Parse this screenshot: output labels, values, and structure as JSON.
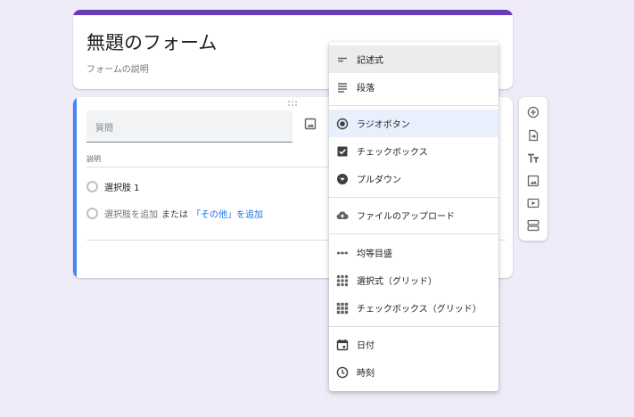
{
  "form": {
    "title": "無題のフォーム",
    "description": "フォームの説明"
  },
  "question": {
    "placeholder": "質問",
    "description_label": "説明",
    "option1": "選択肢 1",
    "add_option": "選択肢を追加",
    "or": "または",
    "add_other": "「その他」を追加"
  },
  "menu": {
    "items": [
      {
        "label": "記述式",
        "icon": "short-answer-icon"
      },
      {
        "label": "段落",
        "icon": "paragraph-icon"
      },
      {
        "label": "ラジオボタン",
        "icon": "radio-button-icon"
      },
      {
        "label": "チェックボックス",
        "icon": "checkbox-icon"
      },
      {
        "label": "プルダウン",
        "icon": "dropdown-icon"
      },
      {
        "label": "ファイルのアップロード",
        "icon": "cloud-upload-icon"
      },
      {
        "label": "均等目盛",
        "icon": "linear-scale-icon"
      },
      {
        "label": "選択式（グリッド）",
        "icon": "multiple-choice-grid-icon"
      },
      {
        "label": "チェックボックス（グリッド）",
        "icon": "checkbox-grid-icon"
      },
      {
        "label": "日付",
        "icon": "calendar-icon"
      },
      {
        "label": "時刻",
        "icon": "clock-icon"
      }
    ]
  },
  "toolbar": {
    "icons": [
      "add-question-icon",
      "import-questions-icon",
      "add-title-icon",
      "add-image-icon",
      "add-video-icon",
      "add-section-icon"
    ]
  },
  "colors": {
    "accent": "#673ab7",
    "focus_bar": "#4285f4",
    "link": "#1a73e8",
    "background": "#efebf8"
  }
}
